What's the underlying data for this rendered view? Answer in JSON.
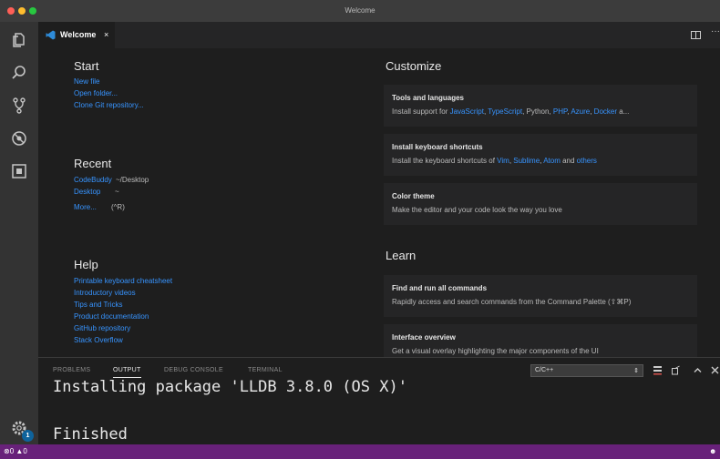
{
  "window": {
    "title": "Welcome"
  },
  "tab": {
    "label": "Welcome",
    "close": "×"
  },
  "start": {
    "heading": "Start",
    "links": [
      "New file",
      "Open folder...",
      "Clone Git repository..."
    ]
  },
  "recent": {
    "heading": "Recent",
    "items": [
      {
        "name": "CodeBuddy",
        "path": "~/Desktop"
      },
      {
        "name": "Desktop",
        "path": "~"
      }
    ],
    "more": "More...",
    "more_shortcut": "(^R)"
  },
  "help": {
    "heading": "Help",
    "links": [
      "Printable keyboard cheatsheet",
      "Introductory videos",
      "Tips and Tricks",
      "Product documentation",
      "GitHub repository",
      "Stack Overflow"
    ]
  },
  "customize": {
    "heading": "Customize",
    "cards": [
      {
        "title": "Tools and languages",
        "desc_prefix": "Install support for ",
        "links": [
          "JavaScript",
          "TypeScript",
          "Python",
          "PHP",
          "Azure",
          "Docker"
        ],
        "seps": [
          ", ",
          ", ",
          ", ",
          ", ",
          ", "
        ],
        "desc_suffix": " a..."
      },
      {
        "title": "Install keyboard shortcuts",
        "desc_prefix": "Install the keyboard shortcuts of ",
        "links": [
          "Vim",
          "Sublime",
          "Atom",
          "others"
        ],
        "seps": [
          ", ",
          ", ",
          " and "
        ],
        "desc_suffix": ""
      },
      {
        "title": "Color theme",
        "desc": "Make the editor and your code look the way you love"
      }
    ]
  },
  "learn": {
    "heading": "Learn",
    "cards": [
      {
        "title": "Find and run all commands",
        "desc": "Rapidly access and search commands from the Command Palette (⇧⌘P)"
      },
      {
        "title": "Interface overview",
        "desc": "Get a visual overlay highlighting the major components of the UI"
      }
    ]
  },
  "panel": {
    "tabs": [
      "PROBLEMS",
      "OUTPUT",
      "DEBUG CONSOLE",
      "TERMINAL"
    ],
    "active_tab": "OUTPUT",
    "channel": "C/C++",
    "channel_arrow": "⇕",
    "output_lines": [
      "Installing package 'LLDB 3.8.0 (OS X)'",
      "Finished"
    ]
  },
  "activity": {
    "settings_badge": "1"
  },
  "status": {
    "errors": "0",
    "warnings": "0"
  },
  "colors": {
    "accent_link": "#3794ff",
    "statusbar": "#68217a",
    "badge": "#0e639c"
  },
  "icons": [
    "explorer-icon",
    "search-icon",
    "source-control-icon",
    "debug-icon",
    "extensions-icon",
    "settings-gear-icon",
    "vscode-logo-icon",
    "split-editor-icon",
    "more-actions-icon",
    "clear-output-icon",
    "lock-scroll-icon",
    "maximize-panel-icon",
    "collapse-panel-icon",
    "close-panel-icon",
    "error-icon",
    "warning-icon",
    "feedback-icon"
  ]
}
